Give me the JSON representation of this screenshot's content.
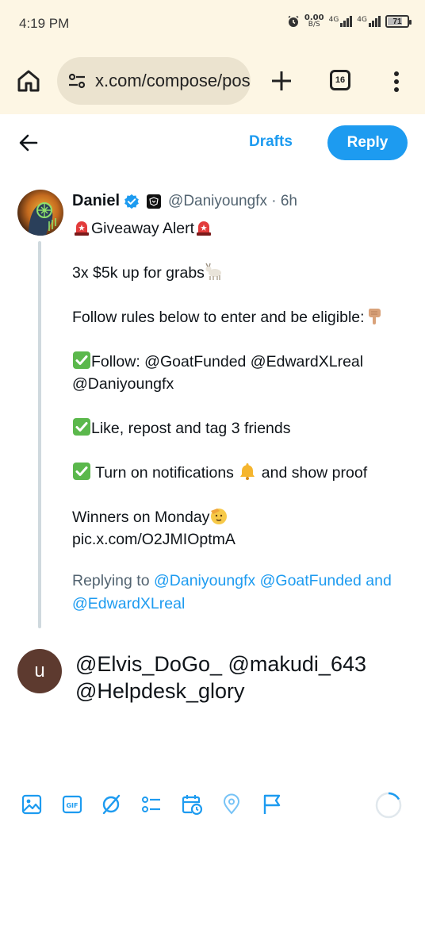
{
  "status": {
    "time": "4:19 PM",
    "speed_value": "0.00",
    "speed_unit": "B/S",
    "network_1": "4G",
    "network_2": "4G",
    "battery": "71",
    "battery_level": 0.71
  },
  "browser": {
    "url": "x.com/compose/pos",
    "tab_count": "16"
  },
  "compose": {
    "drafts_label": "Drafts",
    "reply_label": "Reply"
  },
  "tweet": {
    "name": "Daniel",
    "handle": "@Daniyoungfx",
    "time": "6h",
    "lines": {
      "alert": "Giveaway Alert",
      "prize": "3x $5k up for grabs",
      "rules": "Follow rules below to enter and be eligible:",
      "follow": "Follow: @GoatFunded @EdwardXLreal",
      "follow_2": "@Daniyoungfx",
      "like": "Like, repost and tag 3 friends",
      "notify_a": " Turn on notifications ",
      "notify_b": " and show proof",
      "winners": "Winners on Monday",
      "link": "pic.x.com/O2JMIOptmA"
    },
    "replying_prefix": "Replying to ",
    "replying_1": "@Daniyoungfx",
    "replying_2": "@GoatFunded",
    "replying_and": "and",
    "replying_3": "@EdwardXLreal"
  },
  "reply": {
    "avatar_letter": "u",
    "text_line_1": "@Elvis_DoGo_ @makudi_643",
    "text_line_2": "@Helpdesk_glory"
  },
  "toolbar": {
    "icons": [
      "image-icon",
      "gif-icon",
      "grok-icon",
      "poll-icon",
      "schedule-icon",
      "location-icon",
      "flag-icon"
    ]
  },
  "colors": {
    "accent": "#1d9bf0",
    "browser_bg": "#fdf6e4",
    "secondary_text": "#536471",
    "avatar_bg": "#5d3a2f"
  }
}
